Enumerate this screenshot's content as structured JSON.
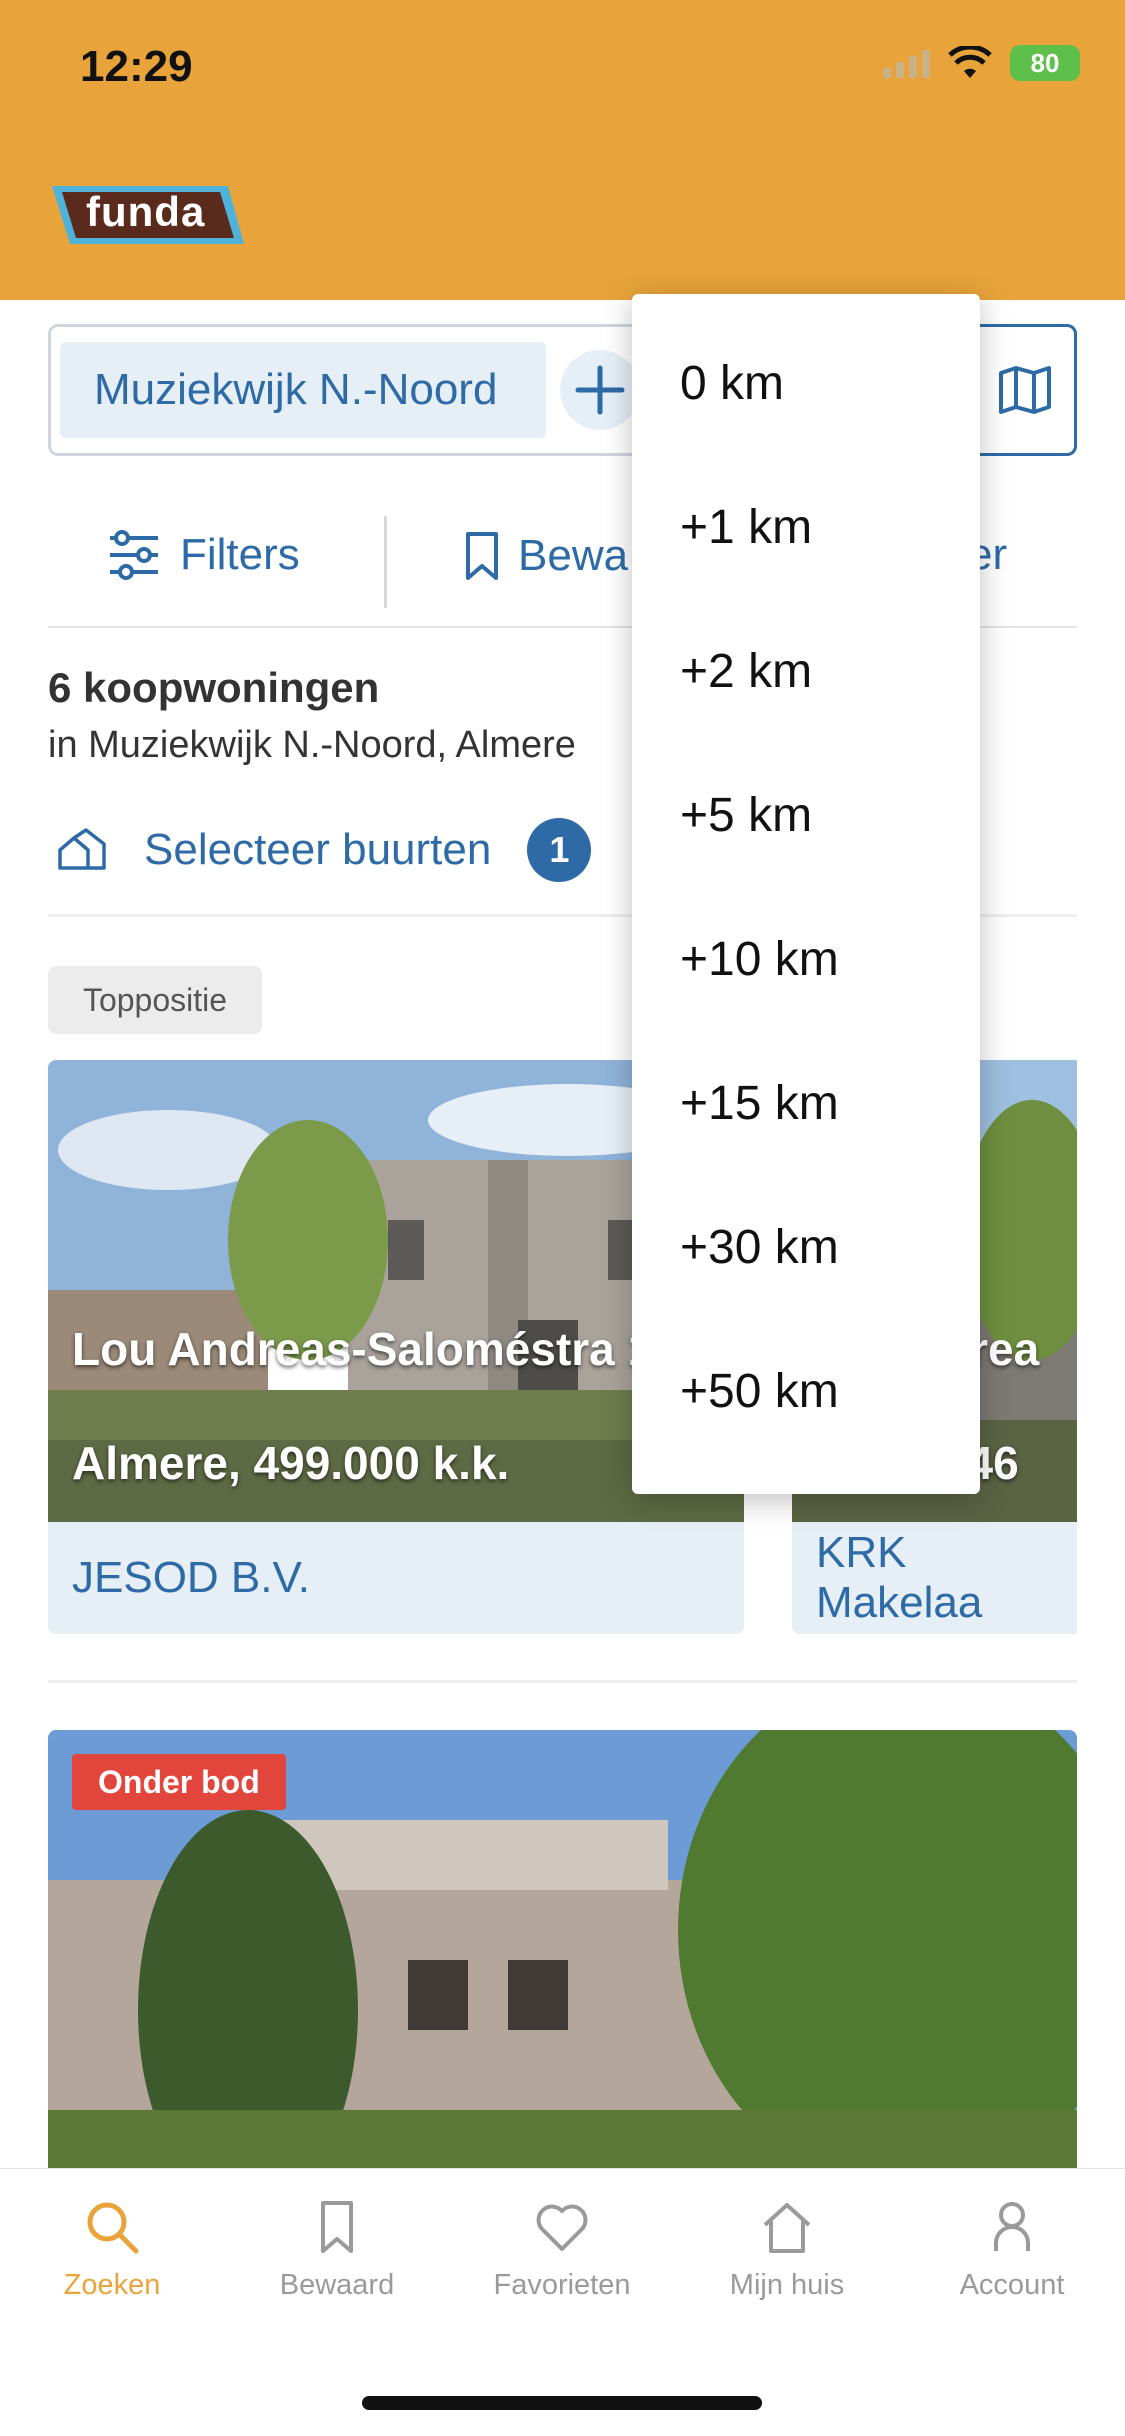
{
  "status_bar": {
    "time": "12:29",
    "battery": "80"
  },
  "brand": {
    "logo_text": "funda",
    "header_color": "#E8A33A",
    "accent_blue": "#2d6aa6"
  },
  "search": {
    "chip_label": "Muziekwijk N.-Noord",
    "add_icon": "plus-icon",
    "map_icon": "map-icon"
  },
  "filter_bar": {
    "filters_label": "Filters",
    "bewaar_label": "Bewa",
    "sorteer_label": "er"
  },
  "results": {
    "title": "6 koopwoningen",
    "subtitle": "in Muziekwijk N.-Noord, Almere",
    "buurten_label": "Selecteer buurten",
    "buurten_count": "1"
  },
  "listings": [
    {
      "tag": "Toppositie",
      "title": "Lou Andreas-Saloméstra 1",
      "price": "Almere, 499.000 k.k.",
      "agent": "JESOD B.V."
    },
    {
      "title": "drea",
      "price": ", 46",
      "agent": "KRK Makelaa"
    },
    {
      "tag": "Onder bod"
    }
  ],
  "radius_dropdown": {
    "options": [
      "0 km",
      "+1 km",
      "+2 km",
      "+5 km",
      "+10 km",
      "+15 km",
      "+30 km",
      "+50 km"
    ]
  },
  "tabbar": {
    "tabs": [
      {
        "label": "Zoeken",
        "icon": "search-icon",
        "active": true
      },
      {
        "label": "Bewaard",
        "icon": "bookmark-icon",
        "active": false
      },
      {
        "label": "Favorieten",
        "icon": "heart-icon",
        "active": false
      },
      {
        "label": "Mijn huis",
        "icon": "home-icon",
        "active": false
      },
      {
        "label": "Account",
        "icon": "person-icon",
        "active": false
      }
    ]
  }
}
